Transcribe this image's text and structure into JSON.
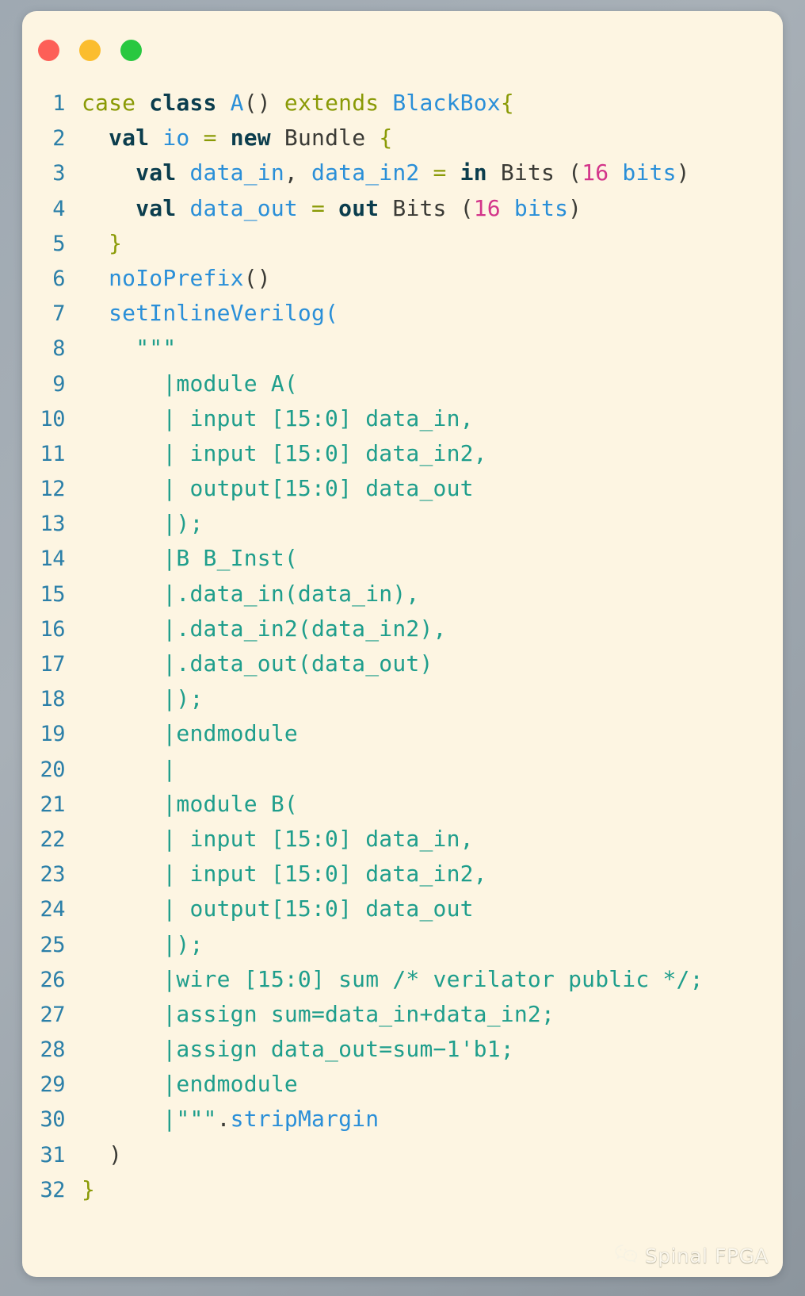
{
  "window": {
    "traffic_lights": [
      {
        "name": "close",
        "color": "#fd5f57"
      },
      {
        "name": "minimize",
        "color": "#fbbd2e"
      },
      {
        "name": "maximize",
        "color": "#28c840"
      }
    ],
    "background_color": "#fdf5e2",
    "page_background_color": "#9fa9b2"
  },
  "editor": {
    "language": "scala",
    "first_line_number": 1,
    "last_line_number": 32,
    "colors": {
      "line_number": "#2b7fa8",
      "keyword": "#0b3d4d",
      "keyword_alt": "#8a9a06",
      "type": "#2a8fd8",
      "number": "#d3358a",
      "string": "#1f9e8c",
      "plain": "#3b3b36"
    },
    "lines": [
      {
        "n": "1",
        "tokens": [
          {
            "t": "case ",
            "c": "t-kw2"
          },
          {
            "t": "class ",
            "c": "t-kw"
          },
          {
            "t": "A",
            "c": "t-type"
          },
          {
            "t": "()",
            "c": "t-plain"
          },
          {
            "t": " extends ",
            "c": "t-kw2"
          },
          {
            "t": "BlackBox",
            "c": "t-type"
          },
          {
            "t": "{",
            "c": "t-kw2"
          }
        ]
      },
      {
        "n": "2",
        "tokens": [
          {
            "t": "  ",
            "c": "t-plain"
          },
          {
            "t": "val",
            "c": "t-kw"
          },
          {
            "t": " ",
            "c": "t-plain"
          },
          {
            "t": "io",
            "c": "t-type"
          },
          {
            "t": " ",
            "c": "t-plain"
          },
          {
            "t": "=",
            "c": "t-kw2"
          },
          {
            "t": " ",
            "c": "t-plain"
          },
          {
            "t": "new",
            "c": "t-kw"
          },
          {
            "t": " Bundle ",
            "c": "t-plain"
          },
          {
            "t": "{",
            "c": "t-kw2"
          }
        ]
      },
      {
        "n": "3",
        "tokens": [
          {
            "t": "    ",
            "c": "t-plain"
          },
          {
            "t": "val",
            "c": "t-kw"
          },
          {
            "t": " ",
            "c": "t-plain"
          },
          {
            "t": "data_in",
            "c": "t-type"
          },
          {
            "t": ",",
            "c": "t-plain"
          },
          {
            "t": " ",
            "c": "t-plain"
          },
          {
            "t": "data_in2",
            "c": "t-type"
          },
          {
            "t": " ",
            "c": "t-plain"
          },
          {
            "t": "=",
            "c": "t-kw2"
          },
          {
            "t": " ",
            "c": "t-plain"
          },
          {
            "t": "in",
            "c": "t-kw"
          },
          {
            "t": " Bits (",
            "c": "t-plain"
          },
          {
            "t": "16",
            "c": "t-num"
          },
          {
            "t": " ",
            "c": "t-plain"
          },
          {
            "t": "bits",
            "c": "t-type"
          },
          {
            "t": ")",
            "c": "t-plain"
          }
        ]
      },
      {
        "n": "4",
        "tokens": [
          {
            "t": "    ",
            "c": "t-plain"
          },
          {
            "t": "val",
            "c": "t-kw"
          },
          {
            "t": " ",
            "c": "t-plain"
          },
          {
            "t": "data_out",
            "c": "t-type"
          },
          {
            "t": " ",
            "c": "t-plain"
          },
          {
            "t": "=",
            "c": "t-kw2"
          },
          {
            "t": " ",
            "c": "t-plain"
          },
          {
            "t": "out",
            "c": "t-kw"
          },
          {
            "t": " Bits (",
            "c": "t-plain"
          },
          {
            "t": "16",
            "c": "t-num"
          },
          {
            "t": " ",
            "c": "t-plain"
          },
          {
            "t": "bits",
            "c": "t-type"
          },
          {
            "t": ")",
            "c": "t-plain"
          }
        ]
      },
      {
        "n": "5",
        "tokens": [
          {
            "t": "  ",
            "c": "t-plain"
          },
          {
            "t": "}",
            "c": "t-kw2"
          }
        ]
      },
      {
        "n": "6",
        "tokens": [
          {
            "t": "  ",
            "c": "t-plain"
          },
          {
            "t": "noIoPrefix",
            "c": "t-fn"
          },
          {
            "t": "()",
            "c": "t-plain"
          }
        ]
      },
      {
        "n": "7",
        "tokens": [
          {
            "t": "  ",
            "c": "t-plain"
          },
          {
            "t": "setInlineVerilog",
            "c": "t-fn"
          },
          {
            "t": "(",
            "c": "t-fn"
          }
        ]
      },
      {
        "n": "8",
        "tokens": [
          {
            "t": "    ",
            "c": "t-plain"
          },
          {
            "t": "\"\"\"",
            "c": "t-str"
          }
        ]
      },
      {
        "n": "9",
        "tokens": [
          {
            "t": "      ",
            "c": "t-plain"
          },
          {
            "t": "|module A(",
            "c": "t-str"
          }
        ]
      },
      {
        "n": "10",
        "tokens": [
          {
            "t": "      ",
            "c": "t-plain"
          },
          {
            "t": "| input [15:0] data_in,",
            "c": "t-str"
          }
        ]
      },
      {
        "n": "11",
        "tokens": [
          {
            "t": "      ",
            "c": "t-plain"
          },
          {
            "t": "| input [15:0] data_in2,",
            "c": "t-str"
          }
        ]
      },
      {
        "n": "12",
        "tokens": [
          {
            "t": "      ",
            "c": "t-plain"
          },
          {
            "t": "| output[15:0] data_out",
            "c": "t-str"
          }
        ]
      },
      {
        "n": "13",
        "tokens": [
          {
            "t": "      ",
            "c": "t-plain"
          },
          {
            "t": "|);",
            "c": "t-str"
          }
        ]
      },
      {
        "n": "14",
        "tokens": [
          {
            "t": "      ",
            "c": "t-plain"
          },
          {
            "t": "|B B_Inst(",
            "c": "t-str"
          }
        ]
      },
      {
        "n": "15",
        "tokens": [
          {
            "t": "      ",
            "c": "t-plain"
          },
          {
            "t": "|.data_in(data_in),",
            "c": "t-str"
          }
        ]
      },
      {
        "n": "16",
        "tokens": [
          {
            "t": "      ",
            "c": "t-plain"
          },
          {
            "t": "|.data_in2(data_in2),",
            "c": "t-str"
          }
        ]
      },
      {
        "n": "17",
        "tokens": [
          {
            "t": "      ",
            "c": "t-plain"
          },
          {
            "t": "|.data_out(data_out)",
            "c": "t-str"
          }
        ]
      },
      {
        "n": "18",
        "tokens": [
          {
            "t": "      ",
            "c": "t-plain"
          },
          {
            "t": "|);",
            "c": "t-str"
          }
        ]
      },
      {
        "n": "19",
        "tokens": [
          {
            "t": "      ",
            "c": "t-plain"
          },
          {
            "t": "|endmodule",
            "c": "t-str"
          }
        ]
      },
      {
        "n": "20",
        "tokens": [
          {
            "t": "      ",
            "c": "t-plain"
          },
          {
            "t": "|",
            "c": "t-str"
          }
        ]
      },
      {
        "n": "21",
        "tokens": [
          {
            "t": "      ",
            "c": "t-plain"
          },
          {
            "t": "|module B(",
            "c": "t-str"
          }
        ]
      },
      {
        "n": "22",
        "tokens": [
          {
            "t": "      ",
            "c": "t-plain"
          },
          {
            "t": "| input [15:0] data_in,",
            "c": "t-str"
          }
        ]
      },
      {
        "n": "23",
        "tokens": [
          {
            "t": "      ",
            "c": "t-plain"
          },
          {
            "t": "| input [15:0] data_in2,",
            "c": "t-str"
          }
        ]
      },
      {
        "n": "24",
        "tokens": [
          {
            "t": "      ",
            "c": "t-plain"
          },
          {
            "t": "| output[15:0] data_out",
            "c": "t-str"
          }
        ]
      },
      {
        "n": "25",
        "tokens": [
          {
            "t": "      ",
            "c": "t-plain"
          },
          {
            "t": "|);",
            "c": "t-str"
          }
        ]
      },
      {
        "n": "26",
        "tokens": [
          {
            "t": "      ",
            "c": "t-plain"
          },
          {
            "t": "|wire [15:0] sum /* verilator public */;",
            "c": "t-str"
          }
        ]
      },
      {
        "n": "27",
        "tokens": [
          {
            "t": "      ",
            "c": "t-plain"
          },
          {
            "t": "|assign sum=data_in+data_in2;",
            "c": "t-str"
          }
        ]
      },
      {
        "n": "28",
        "tokens": [
          {
            "t": "      ",
            "c": "t-plain"
          },
          {
            "t": "|assign data_out=sum−1'b1;",
            "c": "t-str"
          }
        ]
      },
      {
        "n": "29",
        "tokens": [
          {
            "t": "      ",
            "c": "t-plain"
          },
          {
            "t": "|endmodule",
            "c": "t-str"
          }
        ]
      },
      {
        "n": "30",
        "tokens": [
          {
            "t": "      ",
            "c": "t-plain"
          },
          {
            "t": "|\"\"\"",
            "c": "t-str"
          },
          {
            "t": ".",
            "c": "t-punct"
          },
          {
            "t": "stripMargin",
            "c": "t-fn"
          }
        ]
      },
      {
        "n": "31",
        "tokens": [
          {
            "t": "  ",
            "c": "t-plain"
          },
          {
            "t": ")",
            "c": "t-plain"
          }
        ]
      },
      {
        "n": "32",
        "tokens": [
          {
            "t": "",
            "c": "t-plain"
          },
          {
            "t": "}",
            "c": "t-kw2"
          }
        ]
      }
    ]
  },
  "watermark": {
    "icon": "wechat-icon",
    "label": "Spinal FPGA"
  }
}
